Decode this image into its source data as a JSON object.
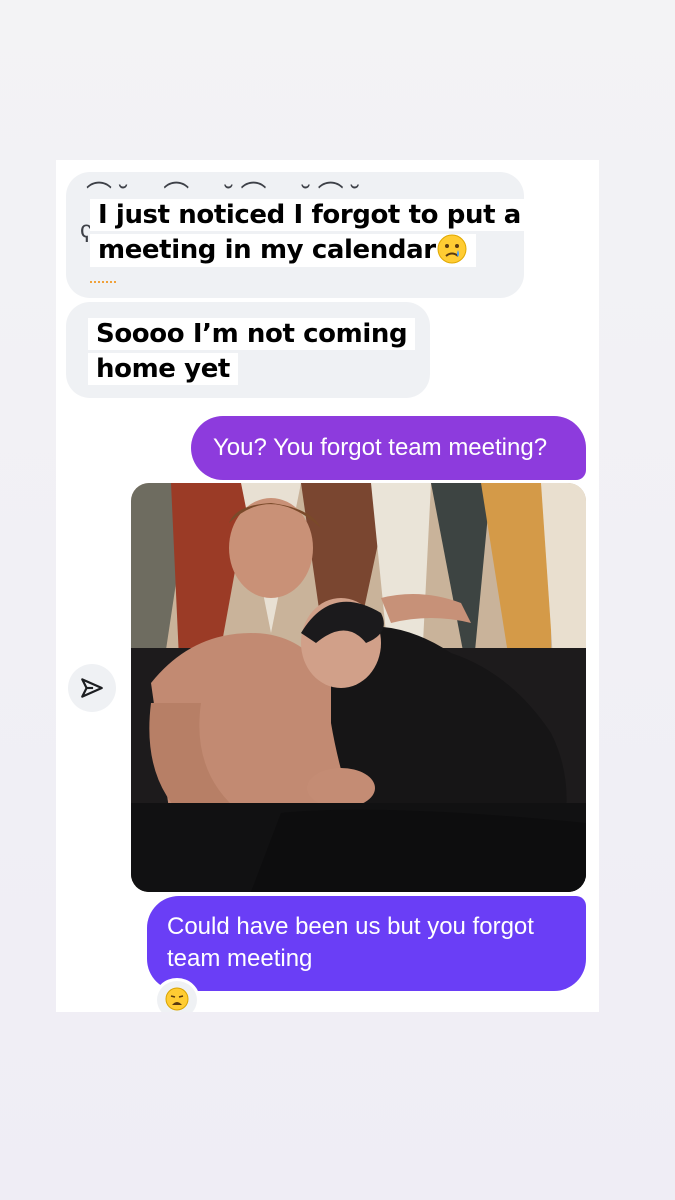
{
  "thread": {
    "incoming": {
      "msg1": {
        "line1": "I just noticed I forgot to put a",
        "line2": "meeting in my calendar",
        "emoji_icon": "crying-face-icon"
      },
      "msg2": {
        "line1": "Soooo I’m not coming",
        "line2": "home yet"
      }
    },
    "outgoing": {
      "msg1": "You? You forgot team meeting?",
      "msg2": "Could have been us but you forgot team meeting"
    },
    "reaction_icon": "weary-face-icon",
    "share_icon": "send-icon"
  },
  "colors": {
    "incoming_bubble": "#eff1f4",
    "outgoing_bubble_1": "#8d3bdd",
    "outgoing_bubble_2": "#6a3ef6"
  }
}
